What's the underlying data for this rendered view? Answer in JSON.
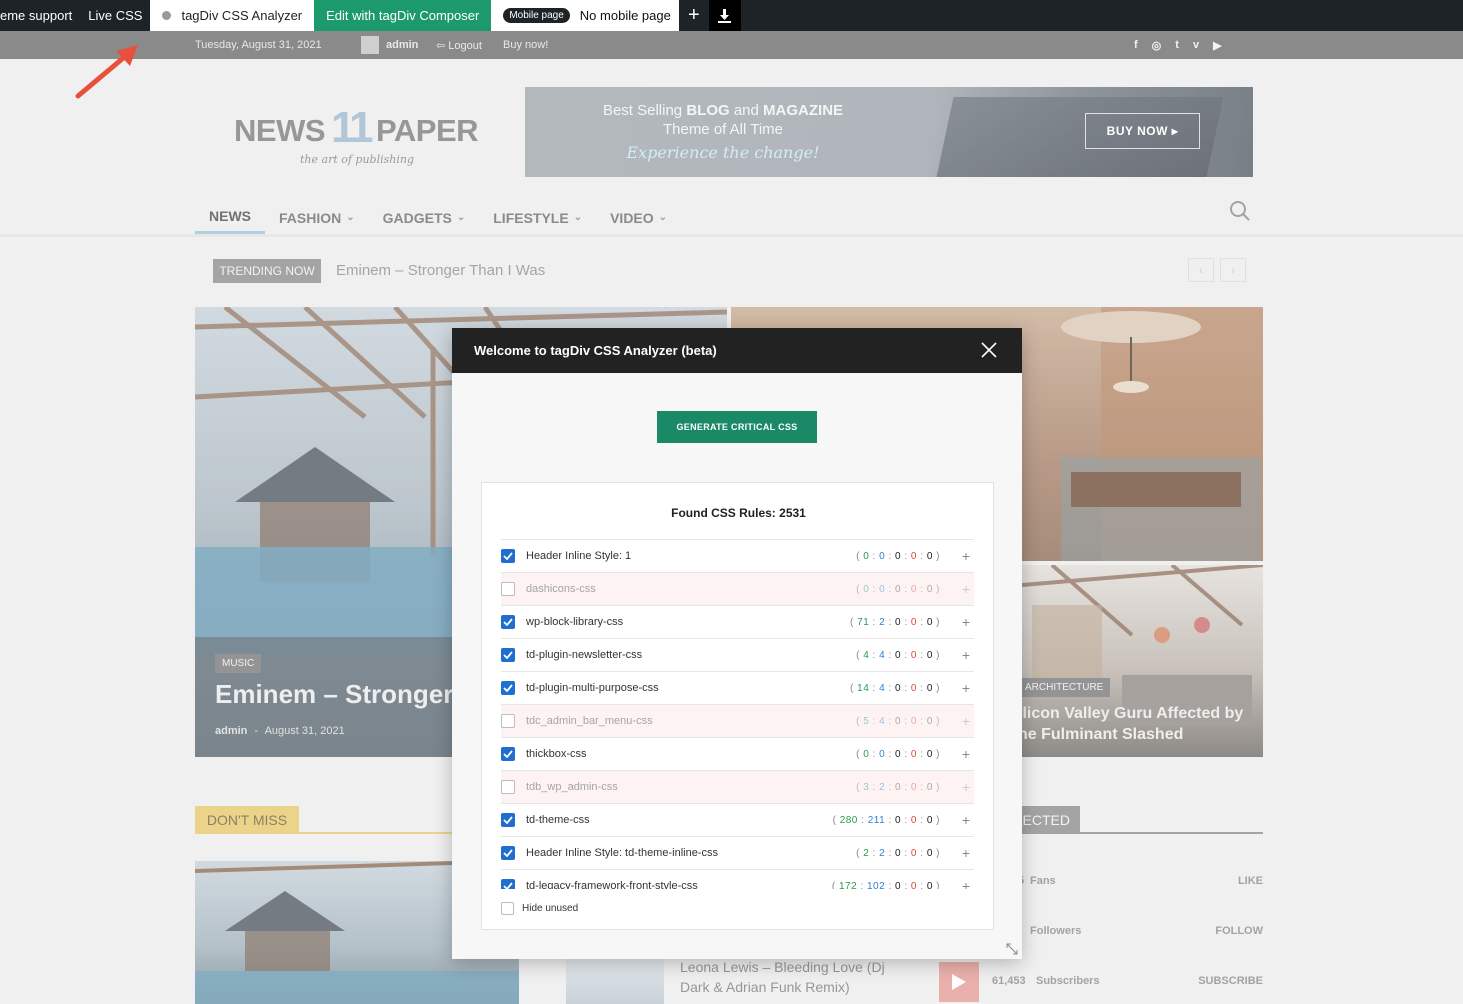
{
  "adminbar": {
    "theme_support": "eme support",
    "live_css": "Live CSS",
    "analyzer": "tagDiv CSS Analyzer",
    "composer": "Edit with tagDiv Composer",
    "mobile_pill": "Mobile page",
    "mobile_status": "No mobile page",
    "plus": "+"
  },
  "topbar": {
    "date": "Tuesday, August 31, 2021",
    "admin": "admin",
    "logout": "Logout",
    "buy_now": "Buy now!",
    "social_icons": [
      "facebook-icon",
      "instagram-icon",
      "twitter-icon",
      "vimeo-icon",
      "youtube-icon"
    ]
  },
  "logo": {
    "word1": "NEWS",
    "number": "11",
    "word2": "PAPER",
    "tagline": "the art of publishing"
  },
  "banner": {
    "line1_pre": "Best Selling ",
    "line1_strong1": "BLOG",
    "line1_mid": " and ",
    "line1_strong2": "MAGAZINE",
    "line2": "Theme of All Time",
    "line3": "Experience the change!",
    "button": "BUY NOW"
  },
  "menu": {
    "items": [
      "NEWS",
      "FASHION",
      "GADGETS",
      "LIFESTYLE",
      "VIDEO"
    ]
  },
  "trending": {
    "label": "TRENDING NOW",
    "title": "Eminem – Stronger Than I Was",
    "prev": "‹",
    "next": "›"
  },
  "hero": {
    "main": {
      "category": "MUSIC",
      "title": "Eminem – Stronger",
      "author": "admin",
      "sep": "-",
      "date": "August 31, 2021"
    },
    "side": {
      "category": "ARCHITECTURE",
      "title_line1": "ilicon Valley Guru Affected by",
      "title_line2": "he Fulminant Slashed"
    }
  },
  "sections": {
    "dont_miss": "DON'T MISS",
    "connected": "ECTED",
    "post_title": "Leona Lewis – Bleeding Love (Dj Dark & Adrian Funk Remix)",
    "social_rows": [
      {
        "num": "5",
        "label": "Fans",
        "action": "LIKE"
      },
      {
        "num": "",
        "label": "Followers",
        "action": "FOLLOW"
      },
      {
        "num": "61,453",
        "label": "Subscribers",
        "action": "SUBSCRIBE"
      }
    ]
  },
  "modal": {
    "title": "Welcome to tagDiv CSS Analyzer (beta)",
    "generate_button": "GENERATE CRITICAL CSS",
    "found_label": "Found CSS Rules: 2531",
    "hide_unused": "Hide unused",
    "rules": [
      {
        "name": "Header Inline Style: 1",
        "checked": true,
        "counts": [
          "0",
          "0",
          "0",
          "0",
          "0"
        ]
      },
      {
        "name": "dashicons-css",
        "checked": false,
        "counts": [
          "0",
          "0",
          "0",
          "0",
          "0"
        ]
      },
      {
        "name": "wp-block-library-css",
        "checked": true,
        "counts": [
          "71",
          "2",
          "0",
          "0",
          "0"
        ]
      },
      {
        "name": "td-plugin-newsletter-css",
        "checked": true,
        "counts": [
          "4",
          "4",
          "0",
          "0",
          "0"
        ]
      },
      {
        "name": "td-plugin-multi-purpose-css",
        "checked": true,
        "counts": [
          "14",
          "4",
          "0",
          "0",
          "0"
        ]
      },
      {
        "name": "tdc_admin_bar_menu-css",
        "checked": false,
        "counts": [
          "5",
          "4",
          "0",
          "0",
          "0"
        ]
      },
      {
        "name": "thickbox-css",
        "checked": true,
        "counts": [
          "0",
          "0",
          "0",
          "0",
          "0"
        ]
      },
      {
        "name": "tdb_wp_admin-css",
        "checked": false,
        "counts": [
          "3",
          "2",
          "0",
          "0",
          "0"
        ]
      },
      {
        "name": "td-theme-css",
        "checked": true,
        "counts": [
          "280",
          "211",
          "0",
          "0",
          "0"
        ]
      },
      {
        "name": "Header Inline Style: td-theme-inline-css",
        "checked": true,
        "counts": [
          "2",
          "2",
          "0",
          "0",
          "0"
        ]
      },
      {
        "name": "td-legacy-framework-front-style-css",
        "checked": true,
        "counts": [
          "172",
          "102",
          "0",
          "0",
          "0"
        ]
      }
    ]
  },
  "colors": {
    "admin_bar": "#1d2327",
    "composer_green": "#1d9a6c",
    "generate_green": "#1a8a66",
    "checkbox_blue": "#1e6fd0",
    "arrow_red": "#e8503c"
  }
}
